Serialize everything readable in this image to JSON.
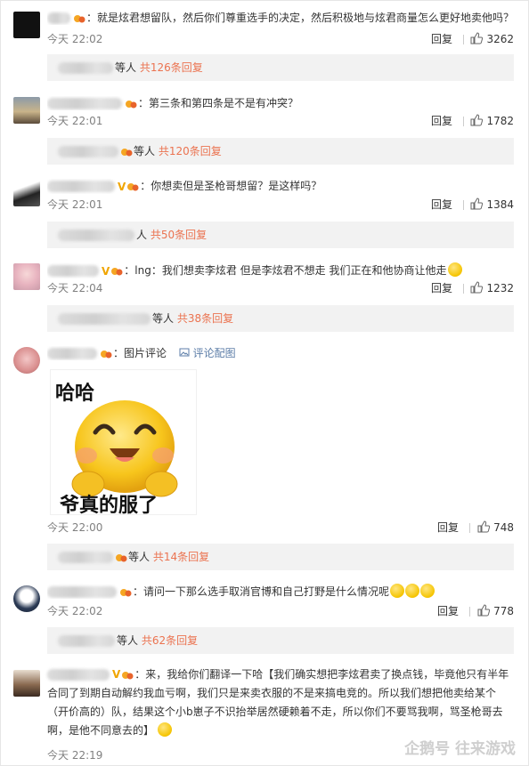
{
  "comments": [
    {
      "text": "：就是炫君想留队，然后你们尊重选手的决定，然后积极地与炫君商量怎么更好地卖他吗？",
      "time": "今天 22:02",
      "reply_label": "回复",
      "likes": "3262",
      "more_suffix": "等人",
      "more_count": "共126条回复"
    },
    {
      "text": "：第三条和第四条是不是有冲突？",
      "time": "今天 22:01",
      "reply_label": "回复",
      "likes": "1782",
      "more_suffix": "等人",
      "more_count": "共120条回复"
    },
    {
      "text": "：你想卖但是圣枪哥想留？是这样吗？",
      "time": "今天 22:01",
      "reply_label": "回复",
      "likes": "1384",
      "more_suffix": "人",
      "more_count": "共50条回复"
    },
    {
      "text": "：lng：我们想卖李炫君 但是李炫君不想走 我们正在和他协商让他走",
      "time": "今天 22:04",
      "reply_label": "回复",
      "likes": "1232",
      "more_suffix": "等人",
      "more_count": "共38条回复"
    },
    {
      "text": "：图片评论",
      "link": "评论配图",
      "sticker_top": "哈哈",
      "sticker_bottom": "爷真的服了",
      "time": "今天 22:00",
      "reply_label": "回复",
      "likes": "748",
      "more_suffix": "等人",
      "more_count": "共14条回复"
    },
    {
      "text": "：请问一下那么选手取消官博和自己打野是什么情况呢",
      "time": "今天 22:02",
      "reply_label": "回复",
      "likes": "778",
      "more_suffix": "等人",
      "more_count": "共62条回复"
    },
    {
      "text": "：来，我给你们翻译一下哈【我们确实想把李炫君卖了换点钱，毕竟他只有半年合同了到期自动解约我血亏啊，我们只是来卖衣服的不是来搞电竞的。所以我们想把他卖给某个（开价高的）队，结果这个小b崽子不识抬举居然硬赖着不走，所以你们不要骂我啊，骂圣枪哥去啊，是他不同意去的】",
      "time": "今天 22:19"
    }
  ],
  "watermark": "企鹅号 往来游戏",
  "accent_color": "#eb7350",
  "icons": [
    "thumbs-up-icon",
    "picture-icon",
    "vip-v-badge",
    "fan-badge"
  ]
}
